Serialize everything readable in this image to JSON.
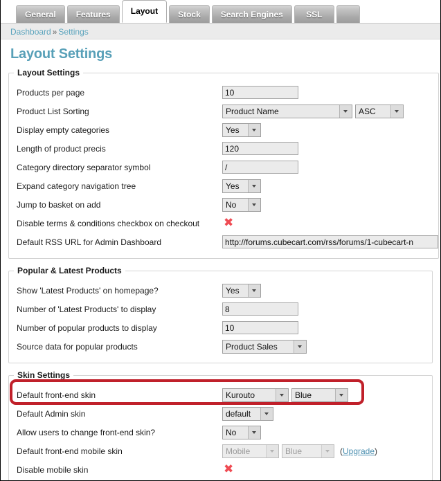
{
  "tabs": [
    {
      "label": "General",
      "active": false
    },
    {
      "label": "Features",
      "active": false
    },
    {
      "label": "Layout",
      "active": true
    },
    {
      "label": "Stock",
      "active": false
    },
    {
      "label": "Search Engines",
      "active": false
    },
    {
      "label": "SSL",
      "active": false
    },
    {
      "label": "",
      "active": false,
      "partial": true
    }
  ],
  "breadcrumb": {
    "root": "Dashboard",
    "separator": "»",
    "current": "Settings"
  },
  "page_title": "Layout Settings",
  "fieldsets": [
    {
      "legend": "Layout Settings",
      "rows": [
        {
          "label": "Products per page",
          "controls": [
            {
              "type": "text",
              "value": "10",
              "size": "small"
            }
          ]
        },
        {
          "label": "Product List Sorting",
          "controls": [
            {
              "type": "select",
              "value": "Product Name",
              "size": "sort"
            },
            {
              "type": "select",
              "value": "ASC",
              "size": "asc"
            }
          ]
        },
        {
          "label": "Display empty categories",
          "controls": [
            {
              "type": "select",
              "value": "Yes",
              "size": "yn"
            }
          ]
        },
        {
          "label": "Length of product precis",
          "controls": [
            {
              "type": "text",
              "value": "120",
              "size": "small"
            }
          ]
        },
        {
          "label": "Category directory separator symbol",
          "controls": [
            {
              "type": "text",
              "value": "/",
              "size": "small"
            }
          ]
        },
        {
          "label": "Expand category navigation tree",
          "controls": [
            {
              "type": "select",
              "value": "Yes",
              "size": "yn"
            }
          ]
        },
        {
          "label": "Jump to basket on add",
          "controls": [
            {
              "type": "select",
              "value": "No",
              "size": "yn"
            }
          ]
        },
        {
          "label": "Disable terms & conditions checkbox on checkout",
          "controls": [
            {
              "type": "xmark",
              "glyph": "✖"
            }
          ]
        },
        {
          "label": "Default RSS URL for Admin Dashboard",
          "controls": [
            {
              "type": "text",
              "value": "http://forums.cubecart.com/rss/forums/1-cubecart-n",
              "size": "url"
            }
          ]
        }
      ]
    },
    {
      "legend": "Popular & Latest Products",
      "rows": [
        {
          "label": "Show 'Latest Products' on homepage?",
          "controls": [
            {
              "type": "select",
              "value": "Yes",
              "size": "yn"
            }
          ]
        },
        {
          "label": "Number of 'Latest Products' to display",
          "controls": [
            {
              "type": "text",
              "value": "8",
              "size": "small"
            }
          ]
        },
        {
          "label": "Number of popular products to display",
          "controls": [
            {
              "type": "text",
              "value": "10",
              "size": "small"
            }
          ]
        },
        {
          "label": "Source data for popular products",
          "controls": [
            {
              "type": "select",
              "value": "Product Sales",
              "size": "src"
            }
          ]
        }
      ]
    },
    {
      "legend": "Skin Settings",
      "rows": [
        {
          "label": "Default front-end skin",
          "controls": [
            {
              "type": "select",
              "value": "Kurouto",
              "size": "skin"
            },
            {
              "type": "select",
              "value": "Blue",
              "size": "color"
            }
          ]
        },
        {
          "label": "Default Admin skin",
          "controls": [
            {
              "type": "select",
              "value": "default",
              "size": "admin"
            }
          ]
        },
        {
          "label": "Allow users to change front-end skin?",
          "controls": [
            {
              "type": "select",
              "value": "No",
              "size": "yn"
            }
          ]
        },
        {
          "label": "Default front-end mobile skin",
          "controls": [
            {
              "type": "select",
              "value": "Mobile",
              "size": "mob",
              "disabled": true
            },
            {
              "type": "select",
              "value": "Blue",
              "size": "mobc",
              "disabled": true
            },
            {
              "type": "upgrade",
              "prefix": "(",
              "link": "Upgrade",
              "suffix": ")"
            }
          ]
        },
        {
          "label": "Disable mobile skin",
          "controls": [
            {
              "type": "xmark",
              "glyph": "✖"
            }
          ]
        }
      ]
    }
  ],
  "annotation": {
    "shape": "rounded-rectangle-highlight",
    "color": "#c0202a",
    "targets": "Default front-end skin"
  },
  "colors": {
    "title": "#58a0b8",
    "link": "#5ba4bd",
    "xmark": "#ef4b53",
    "annotation": "#c0202a",
    "tab_active_bg": "#ffffff"
  }
}
